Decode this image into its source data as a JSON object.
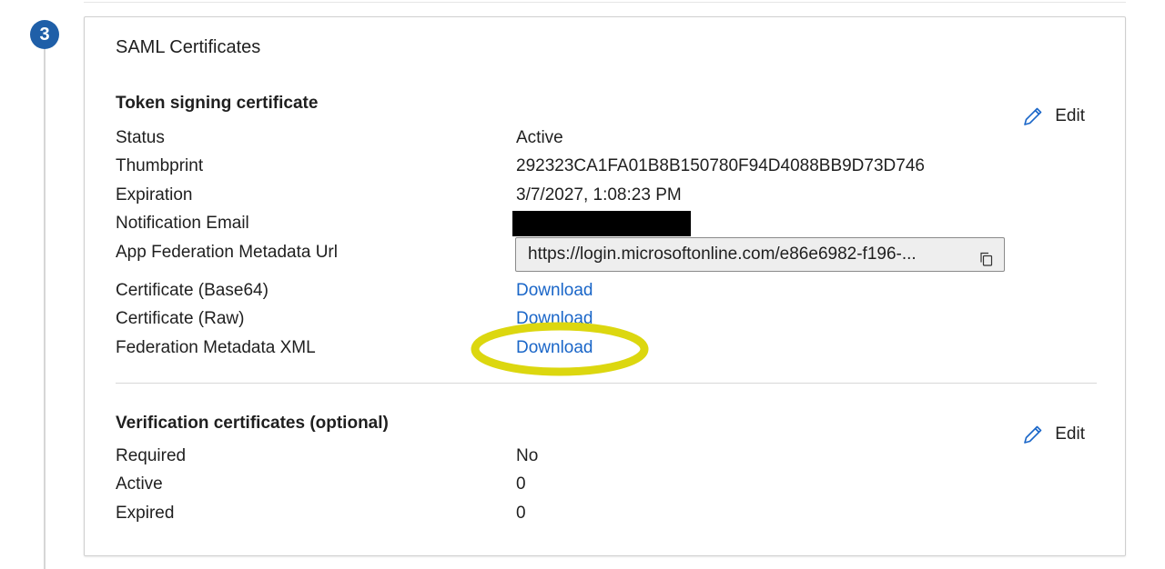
{
  "step": {
    "number": "3"
  },
  "card": {
    "title": "SAML Certificates",
    "token_section": {
      "title": "Token signing certificate",
      "edit_label": "Edit",
      "rows": {
        "status": {
          "label": "Status",
          "value": "Active"
        },
        "thumbprint": {
          "label": "Thumbprint",
          "value": "292323CA1FA01B8B150780F94D4088BB9D73D746"
        },
        "expiration": {
          "label": "Expiration",
          "value": "3/7/2027, 1:08:23 PM"
        },
        "notification_email": {
          "label": "Notification Email"
        },
        "metadata_url": {
          "label": "App Federation Metadata Url",
          "value": "https://login.microsoftonline.com/e86e6982-f196-..."
        },
        "cert_base64": {
          "label": "Certificate (Base64)",
          "link": "Download"
        },
        "cert_raw": {
          "label": "Certificate (Raw)",
          "link": "Download"
        },
        "federation_xml": {
          "label": "Federation Metadata XML",
          "link": "Download"
        }
      }
    },
    "verification_section": {
      "title": "Verification certificates (optional)",
      "edit_label": "Edit",
      "rows": {
        "required": {
          "label": "Required",
          "value": "No"
        },
        "active": {
          "label": "Active",
          "value": "0"
        },
        "expired": {
          "label": "Expired",
          "value": "0"
        }
      }
    }
  },
  "colors": {
    "accent_link": "#1a66c8",
    "step_badge": "#1f5fa8",
    "highlight": "#dcd70f"
  },
  "icons": {
    "edit": "pencil-icon",
    "copy": "copy-icon"
  }
}
